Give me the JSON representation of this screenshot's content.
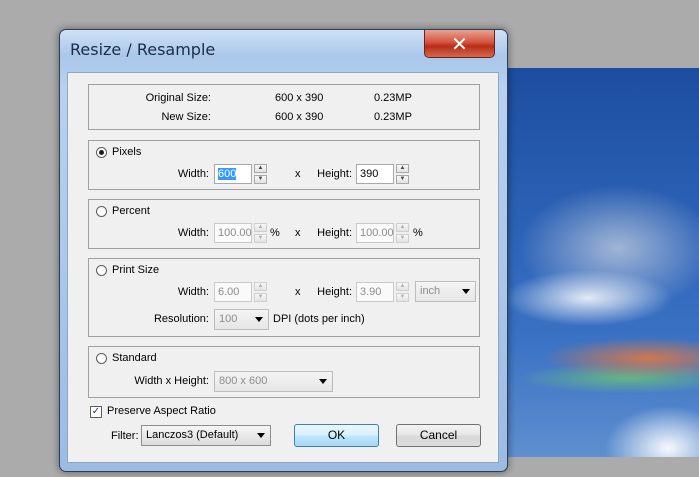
{
  "dialog": {
    "title": "Resize / Resample",
    "close_glyph": "✕"
  },
  "size_info": {
    "original_label": "Original Size:",
    "original_dims": "600 x 390",
    "original_mp": "0.23MP",
    "new_label": "New Size:",
    "new_dims": "600 x 390",
    "new_mp": "0.23MP"
  },
  "pixels": {
    "label": "Pixels",
    "selected": true,
    "width_label": "Width:",
    "width_value": "600",
    "x_sep": "x",
    "height_label": "Height:",
    "height_value": "390"
  },
  "percent": {
    "label": "Percent",
    "width_label": "Width:",
    "width_value": "100.00",
    "unit": "%",
    "x_sep": "x",
    "height_label": "Height:",
    "height_value": "100.00"
  },
  "print_size": {
    "label": "Print Size",
    "width_label": "Width:",
    "width_value": "6.00",
    "x_sep": "x",
    "height_label": "Height:",
    "height_value": "3.90",
    "unit_select": "inch",
    "resolution_label": "Resolution:",
    "resolution_value": "100",
    "dpi_label": "DPI (dots per inch)"
  },
  "standard": {
    "label": "Standard",
    "wh_label": "Width x Height:",
    "wh_value": "800 x 600"
  },
  "preserve_aspect": {
    "label": "Preserve Aspect Ratio",
    "checked": true,
    "check_glyph": "✓"
  },
  "filter": {
    "label": "Filter:",
    "value": "Lanczos3 (Default)"
  },
  "buttons": {
    "ok": "OK",
    "cancel": "Cancel"
  },
  "spin_glyphs": {
    "up": "▲",
    "down": "▼"
  },
  "colors": {
    "close_red": "#c8442c",
    "selection_blue": "#3399ff",
    "desktop_gray": "#ababab"
  }
}
